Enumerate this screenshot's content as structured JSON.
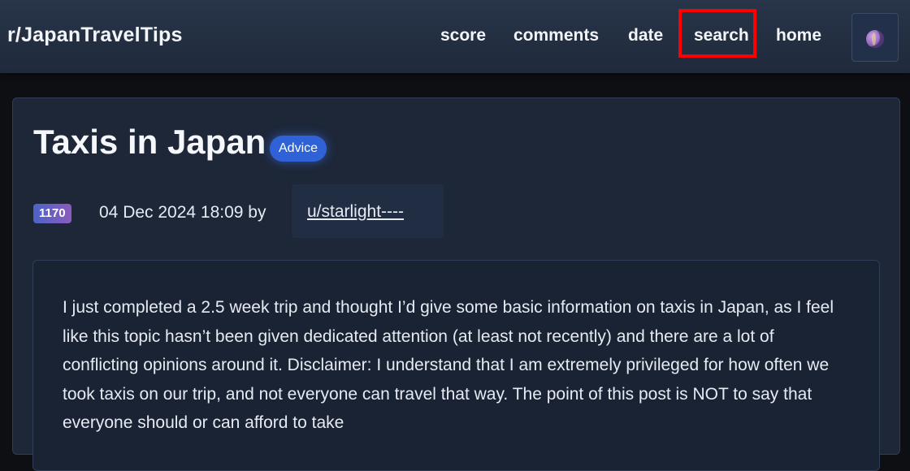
{
  "site": {
    "title": "r/JapanTravelTips"
  },
  "nav": {
    "score": "score",
    "comments": "comments",
    "date": "date",
    "search": "search",
    "home": "home",
    "theme_icon": "moon-icon"
  },
  "post": {
    "title": "Taxis in Japan",
    "flair": "Advice",
    "score": "1170",
    "date_by": "04 Dec 2024 18:09 by",
    "author": "u/starlight----",
    "body": "I just completed a 2.5 week trip and thought I’d give some basic information on taxis in Japan, as I feel like this topic hasn’t been given dedicated attention (at least not recently) and there are a lot of conflicting opinions around it. Disclaimer: I understand that I am extremely privileged for how often we took taxis on our trip, and not everyone can travel that way. The point of this post is NOT to say that everyone should or can afford to take"
  },
  "colors": {
    "highlight": "#ff0000",
    "flair_bg": "#2f62d6",
    "topbar": "#283448",
    "card": "#1d2738"
  }
}
